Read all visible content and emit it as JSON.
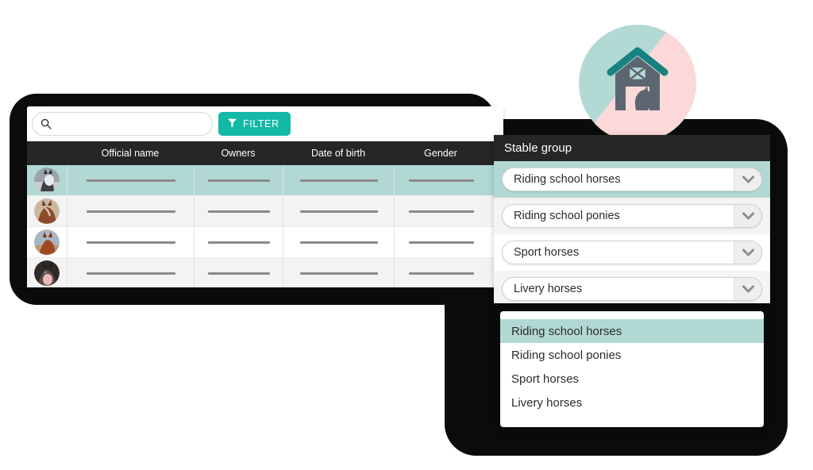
{
  "toolbar": {
    "search_value": "",
    "search_placeholder": "",
    "search_icon": "search-icon",
    "filter_label": "FILTER",
    "filter_icon": "funnel-icon",
    "filter_color": "#14b8a6"
  },
  "table": {
    "columns": [
      "Official name",
      "Owners",
      "Date of birth",
      "Gender"
    ],
    "rows": [
      {
        "avatar": "horse-avatar-gray",
        "selected": true
      },
      {
        "avatar": "horse-avatar-chestnut",
        "selected": false
      },
      {
        "avatar": "horse-avatar-bay",
        "selected": false
      },
      {
        "avatar": "horse-avatar-dark",
        "selected": false
      }
    ],
    "selected_row_color": "#b2d8d4",
    "header_color": "#262626"
  },
  "stable_panel": {
    "title": "Stable group",
    "selects": [
      {
        "value": "Riding school horses",
        "selected": true
      },
      {
        "value": "Riding school ponies",
        "selected": false
      },
      {
        "value": "Sport horses",
        "selected": false
      },
      {
        "value": "Livery horses",
        "selected": false
      }
    ],
    "arrow_icon": "chevron-down-icon"
  },
  "dropdown": {
    "options": [
      {
        "label": "Riding school horses",
        "highlighted": true
      },
      {
        "label": "Riding school ponies",
        "highlighted": false
      },
      {
        "label": "Sport horses",
        "highlighted": false
      },
      {
        "label": "Livery horses",
        "highlighted": false
      }
    ],
    "highlight_color": "#b2d8d4"
  },
  "badge": {
    "icon": "barn-horse-icon",
    "circle_teal": "#b3d9d5",
    "circle_pink": "#fbd9d8",
    "barn_body": "#5c6670",
    "barn_roof": "#17827f"
  }
}
